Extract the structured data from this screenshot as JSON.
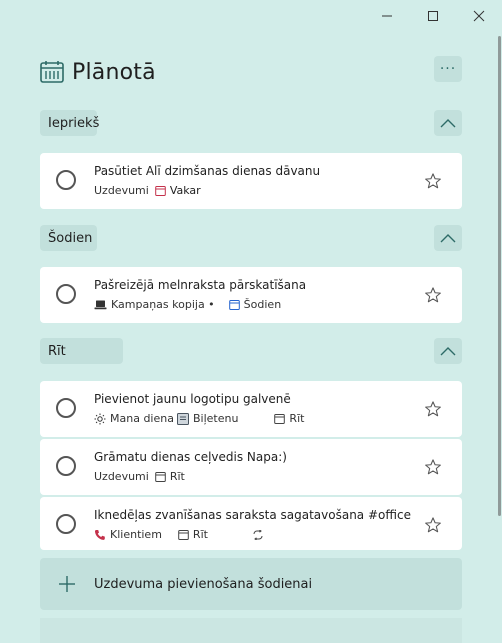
{
  "header": {
    "title": "Plānotā",
    "more_label": "···"
  },
  "sections": [
    {
      "label": "Iepriekš"
    },
    {
      "label": "Šodien"
    },
    {
      "label": "Rīt"
    }
  ],
  "tasks": [
    {
      "title": "Pasūtiet Alī dzimšanas dienas dāvanu",
      "list": "Uzdevumi",
      "due": "Vakar"
    },
    {
      "title": "Pašreizējā melnraksta pārskatīšana",
      "list": "Kampaņas kopija •",
      "due": "Šodien"
    },
    {
      "title": "Pievienot jaunu logotipu galvenē",
      "list": "Mana diena",
      "attachment": "Biļetenu",
      "due": "Rīt"
    },
    {
      "title": "Grāmatu dienas ceļvedis Napa:)",
      "list": "Uzdevumi",
      "due": "Rīt"
    },
    {
      "title": "Iknedēļas zvanīšanas saraksta sagatavošana #office",
      "list": "Klientiem",
      "due": "Rīt"
    }
  ],
  "add_task": {
    "label": "Uzdevuma pievienošana šodienai"
  },
  "colors": {
    "background": "#d2ede9",
    "accent": "#2d6b67",
    "overdue": "#c4314b",
    "today": "#2564cf"
  }
}
